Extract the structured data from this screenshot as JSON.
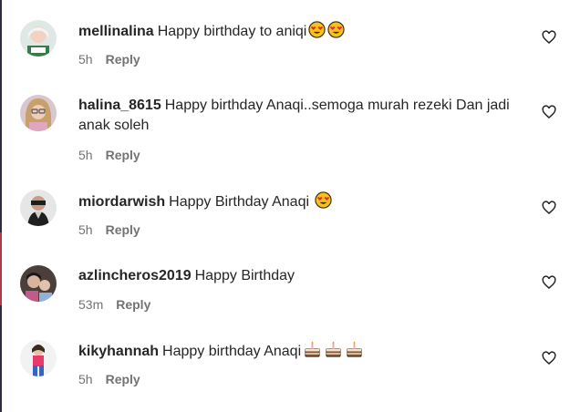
{
  "comments": [
    {
      "username": "mellinalina",
      "text": "Happy birthday to aniqi",
      "emojis": [
        "heart-eyes",
        "heart-eyes"
      ],
      "time": "5h",
      "reply_label": "Reply"
    },
    {
      "username": "halina_8615",
      "text": "Happy birthday Anaqi..semoga murah rezeki Dan jadi anak soleh",
      "emojis": [],
      "time": "5h",
      "reply_label": "Reply"
    },
    {
      "username": "miordarwish",
      "text": "Happy Birthday Anaqi",
      "emojis": [
        "heart-eyes"
      ],
      "time": "5h",
      "reply_label": "Reply"
    },
    {
      "username": "azlincheros2019",
      "text": "Happy Birthday",
      "emojis": [],
      "time": "53m",
      "reply_label": "Reply"
    },
    {
      "username": "kikyhannah",
      "text": "Happy birthday Anaqi",
      "emojis": [
        "birthday-cake",
        "birthday-cake",
        "birthday-cake"
      ],
      "time": "5h",
      "reply_label": "Reply"
    }
  ],
  "colors": {
    "text": "#262626",
    "meta": "#737373",
    "emoji_face": "#f7c21a",
    "heart": "#e8283c",
    "cake": "#8a5a3b"
  }
}
